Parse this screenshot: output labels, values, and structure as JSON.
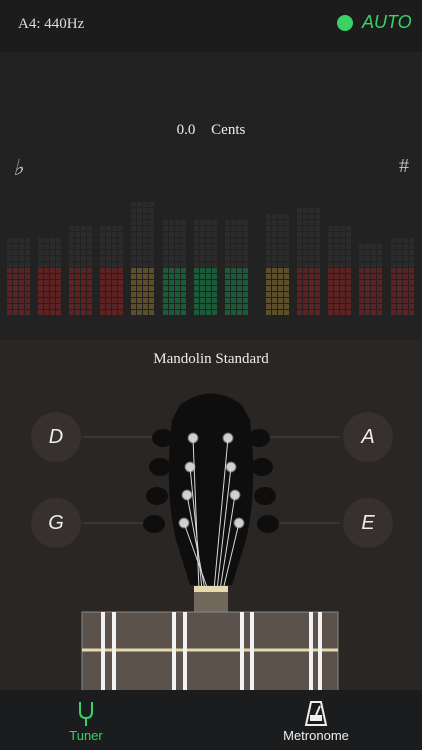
{
  "header": {
    "reference_pitch": "A4: 440Hz",
    "mode_label": "AUTO",
    "mode_color": "#3ad166"
  },
  "meter": {
    "value": "0.0",
    "unit": "Cents",
    "flat_symbol": "♭",
    "sharp_symbol": "#"
  },
  "tuning": {
    "name": "Mandolin Standard",
    "left_strings": [
      "D",
      "G"
    ],
    "right_strings": [
      "A",
      "E"
    ]
  },
  "tabs": [
    {
      "label": "Tuner",
      "icon": "tuning-fork-icon",
      "active": true
    },
    {
      "label": "Metronome",
      "icon": "metronome-icon",
      "active": false
    }
  ]
}
